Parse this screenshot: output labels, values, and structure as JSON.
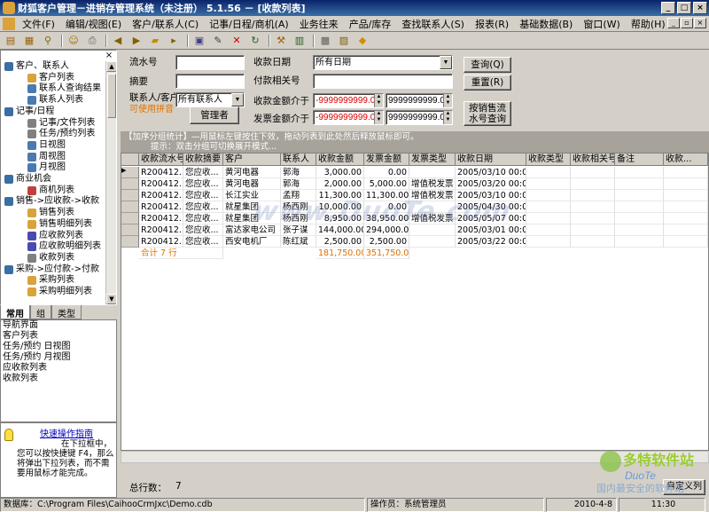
{
  "window": {
    "title": "财狐客户管理－进销存管理系统（未注册） 5.1.56 － [收款列表]",
    "min": "_",
    "max": "□",
    "close": "×"
  },
  "menu": [
    "文件(F)",
    "编辑/视图(E)",
    "客户/联系人(C)",
    "记事/日程/商机(A)",
    "业务往来",
    "产品/库存",
    "查找联系人(S)",
    "报表(R)",
    "基础数据(B)",
    "窗口(W)",
    "帮助(H)"
  ],
  "tree": {
    "close": "×",
    "items": [
      {
        "label": "客户、联系人",
        "level": 0,
        "color": "#3a6ea5"
      },
      {
        "label": "客户列表",
        "level": 1,
        "color": "#d9a23a"
      },
      {
        "label": "联系人查询结果",
        "level": 1,
        "color": "#4a7ab0"
      },
      {
        "label": "联系人列表",
        "level": 1,
        "color": "#4a7ab0"
      },
      {
        "label": "记事/日程",
        "level": 0,
        "color": "#3a6ea5"
      },
      {
        "label": "记事/文件列表",
        "level": 1,
        "color": "#808080"
      },
      {
        "label": "任务/预约列表",
        "level": 1,
        "color": "#808080"
      },
      {
        "label": "日视图",
        "level": 1,
        "color": "#4a7ab0"
      },
      {
        "label": "周视图",
        "level": 1,
        "color": "#4a7ab0"
      },
      {
        "label": "月视图",
        "level": 1,
        "color": "#4a7ab0"
      },
      {
        "label": "商业机会",
        "level": 0,
        "color": "#3a6ea5"
      },
      {
        "label": "商机列表",
        "level": 1,
        "color": "#c04040"
      },
      {
        "label": "销售->应收款->收款",
        "level": 0,
        "color": "#3a6ea5"
      },
      {
        "label": "销售列表",
        "level": 1,
        "color": "#d9a23a"
      },
      {
        "label": "销售明细列表",
        "level": 1,
        "color": "#d9a23a"
      },
      {
        "label": "应收款列表",
        "level": 1,
        "color": "#4a4ab0"
      },
      {
        "label": "应收款明细列表",
        "level": 1,
        "color": "#4a4ab0"
      },
      {
        "label": "收款列表",
        "level": 1,
        "color": "#808080"
      },
      {
        "label": "采购->应付款->付款",
        "level": 0,
        "color": "#3a6ea5"
      },
      {
        "label": "采购列表",
        "level": 1,
        "color": "#d9a23a"
      },
      {
        "label": "采购明细列表",
        "level": 1,
        "color": "#d9a23a"
      }
    ]
  },
  "tabs": [
    "常用",
    "组",
    "类型"
  ],
  "quicklist": [
    "导航界面",
    "客户列表",
    "任务/预约 日视图",
    "任务/预约 月视图",
    "应收款列表",
    "收款列表"
  ],
  "tip": {
    "title": "快速操作指南",
    "text": "在下拉框中，您可以按快捷键 F4，那么将弹出下拉列表，而不需要用鼠标才能完成。"
  },
  "filters": {
    "serial_label": "流水号",
    "serial_value": "",
    "summary_label": "摘要",
    "summary_value": "",
    "contact_label": "联系人/客户",
    "contact_value": "所有联系人",
    "pinyin_hint": "可使用拼音",
    "manager_btn": "管理者",
    "date_label": "收款日期",
    "date_value": "所有日期",
    "related_label": "付款相关号",
    "related_value": "",
    "amount_label": "收款金额介于",
    "amount_min": "-9999999999.0",
    "amount_max": "9999999999.0",
    "invoice_label": "发票金额介于",
    "invoice_min": "-9999999999.0",
    "invoice_max": "9999999999.0",
    "query_btn": "查询(Q)",
    "reset_btn": "重置(R)",
    "sales_query_btn": "按销售流水号查询"
  },
  "hint": {
    "line1": "【加序分组统计】—用鼠标左键按住下效，拖动列表到此处然后释放鼠标即可。",
    "line2": "提示：双击分组可切换展开模式..."
  },
  "grid": {
    "columns": [
      "收款流水号",
      "收款摘要",
      "客户",
      "联系人",
      "收款金额",
      "发票金额",
      "发票类型",
      "收款日期",
      "收款类型",
      "收款相关号",
      "备注",
      "收款..."
    ],
    "rows": [
      [
        "R200412...",
        "您应收...",
        "黄河电器",
        "郭海",
        "3,000.00",
        "0.00",
        "",
        "2005/03/10 00:00",
        "",
        "",
        "",
        ""
      ],
      [
        "R200412...",
        "您应收...",
        "黄河电器",
        "郭海",
        "2,000.00",
        "5,000.00",
        "增值税发票",
        "2005/03/20 00:00",
        "",
        "",
        "",
        ""
      ],
      [
        "R200412...",
        "您应收...",
        "长江实业",
        "孟翔",
        "11,300.00",
        "11,300.00",
        "增值税发票",
        "2005/03/10 00:00",
        "",
        "",
        "",
        ""
      ],
      [
        "R200412...",
        "您应收...",
        "就星集团",
        "杨西刚",
        "10,000.00",
        "0.00",
        "",
        "2005/04/30 00:00",
        "",
        "",
        "",
        ""
      ],
      [
        "R200412...",
        "您应收...",
        "就星集团",
        "杨西刚",
        "8,950.00",
        "38,950.00",
        "增值税发票",
        "2005/05/07 00:00",
        "",
        "",
        "",
        ""
      ],
      [
        "R200412...",
        "您应收...",
        "富达家电公司",
        "张子谋",
        "144,000.00",
        "294,000.00",
        "",
        "2005/03/01 00:00",
        "",
        "",
        "",
        ""
      ],
      [
        "R200412...",
        "您应收...",
        "西安电机厂",
        "陈红斌",
        "2,500.00",
        "2,500.00",
        "",
        "2005/03/22 00:00",
        "",
        "",
        "",
        ""
      ]
    ],
    "total_label": "合计 7 行",
    "total_amount": "181,750.00",
    "total_invoice": "351,750.00"
  },
  "watermark": "www.DuoTe.com",
  "footer": {
    "count_label": "总行数：",
    "count_value": "7",
    "custom_btn": "自定义列"
  },
  "status": {
    "db": "数据库：C:\\Program Files\\CaihooCrmJxc\\Demo.cdb",
    "operator": "操作员：系统管理员",
    "date": "2010-4-8",
    "time": "11:30"
  },
  "logo": {
    "text": "多特软件站",
    "sub": "DuoTe",
    "tagline": "国内最安全的软件站"
  }
}
